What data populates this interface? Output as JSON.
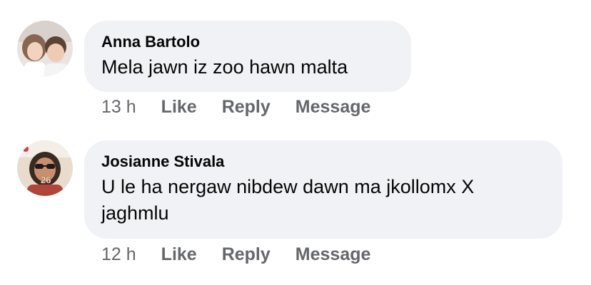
{
  "comments": [
    {
      "author": "Anna Bartolo",
      "text": "Mela jawn iz zoo hawn malta",
      "time": "13 h",
      "actions": {
        "like": "Like",
        "reply": "Reply",
        "message": "Message"
      },
      "avatar_icon": "two-children-photo"
    },
    {
      "author": "Josianne Stivala",
      "text": "U le ha nergaw nibdew dawn ma jkollomx X jaghmlu",
      "time": "12 h",
      "actions": {
        "like": "Like",
        "reply": "Reply",
        "message": "Message"
      },
      "avatar_icon": "woman-sunglasses-photo"
    }
  ],
  "colors": {
    "bubble": "#f0f2f5",
    "text": "#050505",
    "secondary": "#65676b"
  }
}
